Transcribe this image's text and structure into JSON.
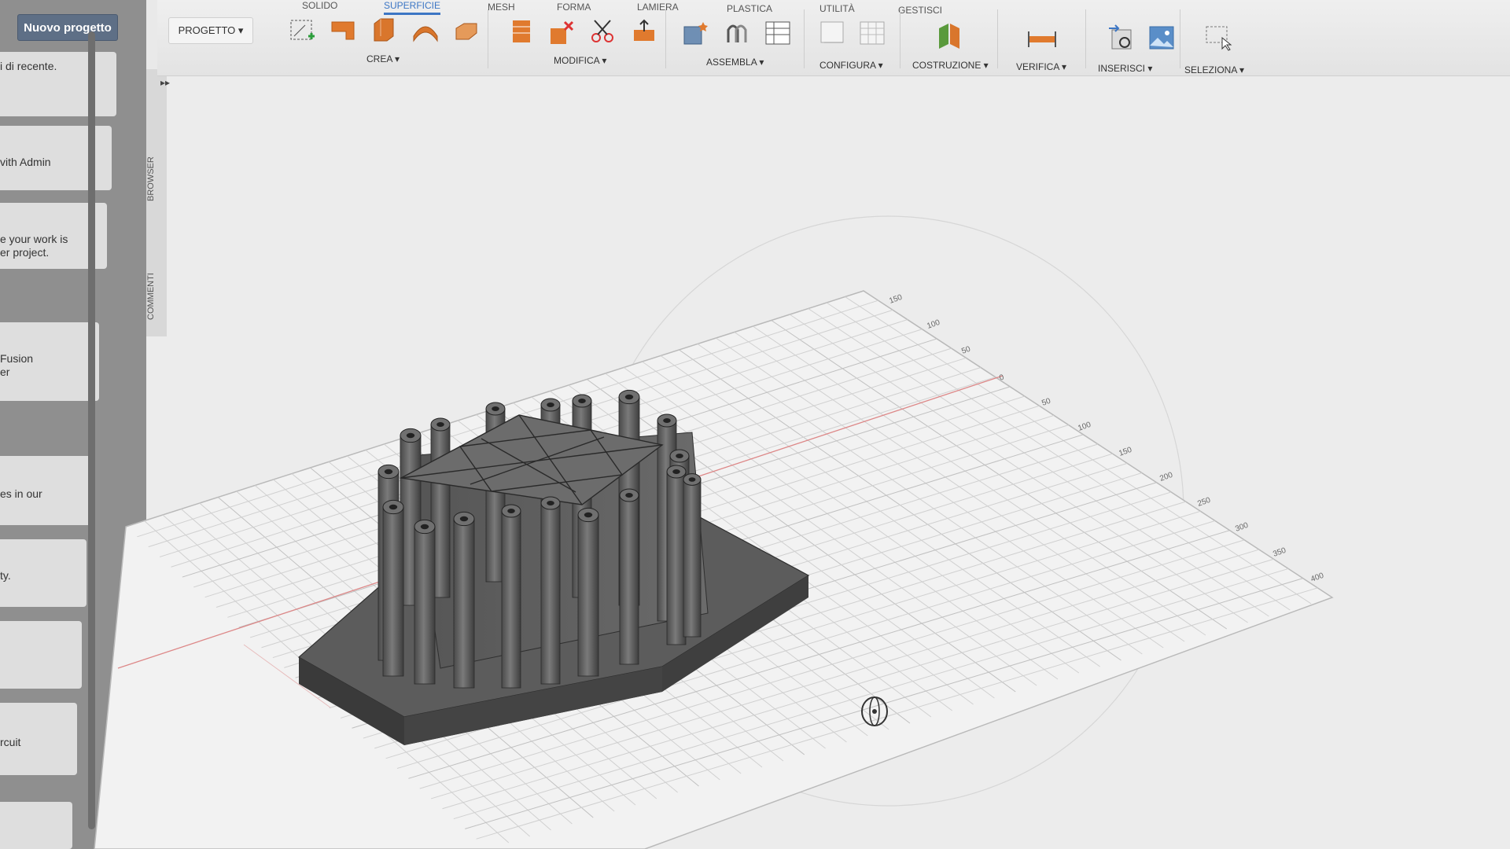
{
  "left_panel": {
    "new_project_label": "Nuovo progetto",
    "cards": [
      {
        "line1": "i di recente.",
        "line2": ""
      },
      {
        "line1": "vith Admin",
        "line2": ""
      },
      {
        "line1": "e your work is",
        "line2": "er project."
      },
      {
        "line1": "Fusion",
        "line2": "er"
      },
      {
        "line1": "es in our",
        "line2": ""
      },
      {
        "line1": "ty.",
        "line2": ""
      },
      {
        "line1": "",
        "line2": ""
      },
      {
        "line1": "rcuit",
        "line2": ""
      },
      {
        "line1": "",
        "line2": ""
      }
    ]
  },
  "side_tabs": {
    "browser": "BROWSER",
    "comments": "COMMENTI"
  },
  "toolbar": {
    "project_label": "PROGETTO",
    "tabs": [
      "SOLIDO",
      "SUPERFICIE",
      "MESH",
      "FORMA",
      "LAMIERA",
      "PLASTICA",
      "UTILITÀ",
      "GESTISCI"
    ],
    "active_tab": "SUPERFICIE",
    "groups": [
      "CREA",
      "MODIFICA",
      "ASSEMBLA",
      "CONFIGURA",
      "COSTRUZIONE",
      "VERIFICA",
      "INSERISCI",
      "SELEZIONA"
    ],
    "accent": "#3c76c4"
  },
  "viewport": {
    "grid_labels_right": [
      "150",
      "100",
      "50",
      "0",
      "50",
      "100",
      "150",
      "200",
      "250",
      "300",
      "350",
      "400"
    ],
    "model_color": "#5b5b5b"
  }
}
